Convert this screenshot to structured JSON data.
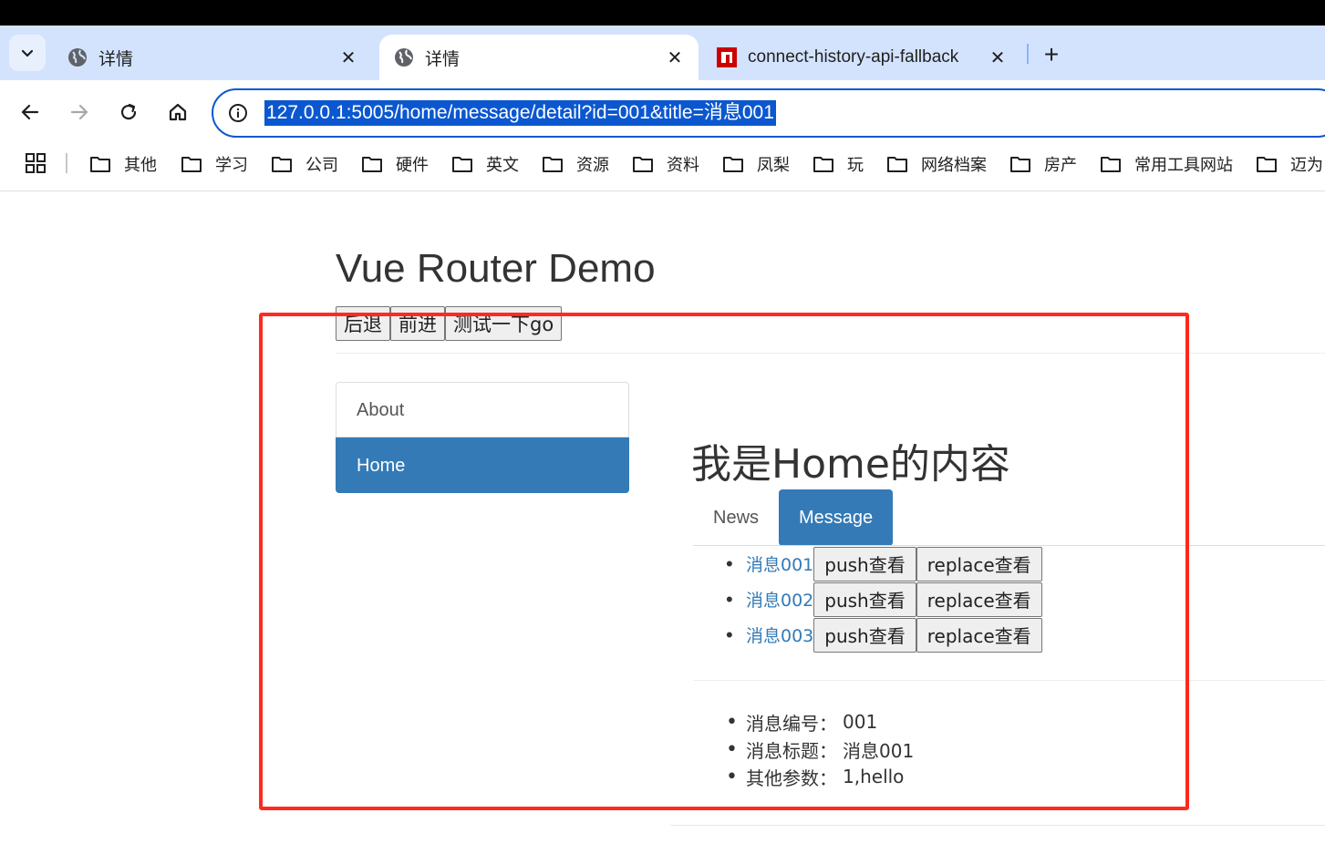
{
  "browser": {
    "tabs": [
      {
        "title": "详情",
        "icon": "globe-icon",
        "active": false
      },
      {
        "title": "详情",
        "icon": "globe-icon",
        "active": true
      },
      {
        "title": "connect-history-api-fallback",
        "icon": "npm-icon",
        "active": false
      }
    ],
    "close_glyph": "✕",
    "new_tab_glyph": "+",
    "url": "127.0.0.1:5005/home/message/detail?id=001&title=消息001",
    "bookmarks": [
      "其他",
      "学习",
      "公司",
      "硬件",
      "英文",
      "资源",
      "资料",
      "凤梨",
      "玩",
      "网络档案",
      "房产",
      "常用工具网站",
      "迈为"
    ]
  },
  "page": {
    "title": "Vue Router Demo",
    "history_buttons": [
      "后退",
      "前进",
      "测试一下go"
    ],
    "sidebar": [
      {
        "label": "About",
        "active": false
      },
      {
        "label": "Home",
        "active": true
      }
    ],
    "home_heading": "我是Home的内容",
    "subnav": [
      {
        "label": "News",
        "active": false
      },
      {
        "label": "Message",
        "active": true
      }
    ],
    "messages": [
      {
        "title": "消息001",
        "push": "push查看",
        "replace": "replace查看"
      },
      {
        "title": "消息002",
        "push": "push查看",
        "replace": "replace查看"
      },
      {
        "title": "消息003",
        "push": "push查看",
        "replace": "replace查看"
      }
    ],
    "detail": [
      {
        "label": "消息编号：",
        "value": "001"
      },
      {
        "label": "消息标题：",
        "value": "消息001"
      },
      {
        "label": "其他参数：",
        "value": "1,hello"
      }
    ]
  },
  "colors": {
    "primary": "#337ab7",
    "annotation": "#ff2a1f",
    "tabstrip": "#d3e3fd",
    "url_highlight": "#0b57d0"
  }
}
